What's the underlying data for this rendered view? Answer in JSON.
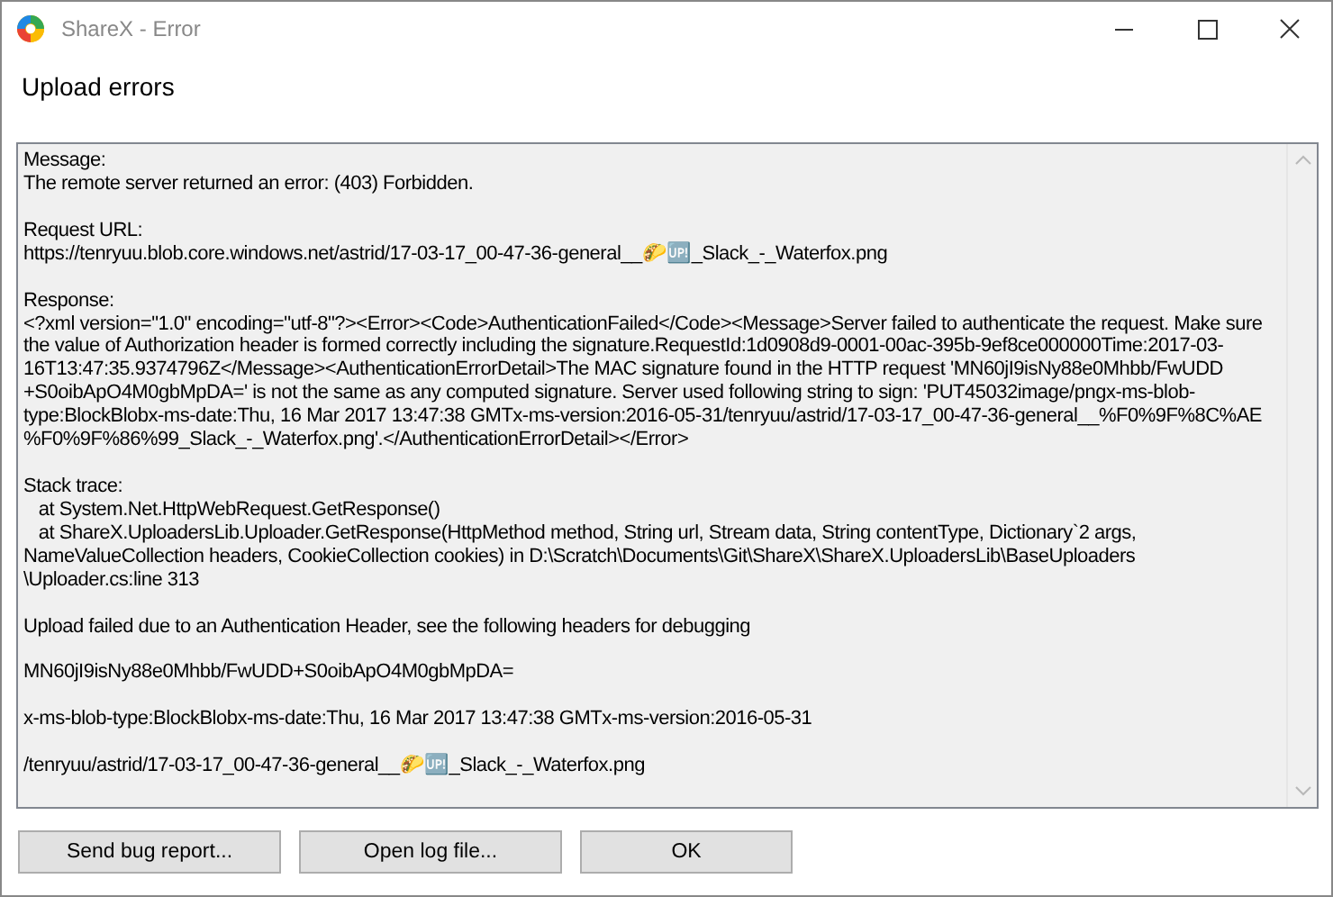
{
  "window": {
    "title": "ShareX - Error"
  },
  "heading": "Upload errors",
  "error_text": [
    {
      "lines": [
        "Message:",
        "The remote server returned an error: (403) Forbidden."
      ]
    },
    {
      "lines": [
        "Request URL:",
        "https://tenryuu.blob.core.windows.net/astrid/17-03-17_00-47-36-general__🌮🆙_Slack_-_Waterfox.png"
      ]
    },
    {
      "lines": [
        "Response:",
        "<?xml version=\"1.0\" encoding=\"utf-8\"?><Error><Code>AuthenticationFailed</Code><Message>Server failed to authenticate the request. Make sure",
        "the value of Authorization header is formed correctly including the signature.RequestId:1d0908d9-0001-00ac-395b-9ef8ce000000Time:2017-03-",
        "16T13:47:35.9374796Z</Message><AuthenticationErrorDetail>The MAC signature found in the HTTP request 'MN60jI9isNy88e0Mhbb/FwUDD",
        "+S0oibApO4M0gbMpDA=' is not the same as any computed signature. Server used following string to sign: 'PUT45032image/pngx-ms-blob-",
        "type:BlockBlobx-ms-date:Thu, 16 Mar 2017 13:47:38 GMTx-ms-version:2016-05-31/tenryuu/astrid/17-03-17_00-47-36-general__%F0%9F%8C%AE",
        "%F0%9F%86%99_Slack_-_Waterfox.png'.</AuthenticationErrorDetail></Error>"
      ]
    },
    {
      "lines": [
        "Stack trace:",
        "   at System.Net.HttpWebRequest.GetResponse()",
        "   at ShareX.UploadersLib.Uploader.GetResponse(HttpMethod method, String url, Stream data, String contentType, Dictionary`2 args,",
        "NameValueCollection headers, CookieCollection cookies) in D:\\Scratch\\Documents\\Git\\ShareX\\ShareX.UploadersLib\\BaseUploaders",
        "\\Uploader.cs:line 313"
      ]
    },
    {
      "lines": [
        "Upload failed due to an Authentication Header, see the following headers for debugging"
      ]
    },
    {
      "lines": [
        "MN60jI9isNy88e0Mhbb/FwUDD+S0oibApO4M0gbMpDA="
      ]
    },
    {
      "lines": [
        "x-ms-blob-type:BlockBlobx-ms-date:Thu, 16 Mar 2017 13:47:38 GMTx-ms-version:2016-05-31"
      ]
    },
    {
      "lines": [
        "/tenryuu/astrid/17-03-17_00-47-36-general__🌮🆙_Slack_-_Waterfox.png"
      ]
    }
  ],
  "buttons": [
    "Send bug report...",
    "Open log file...",
    "OK"
  ]
}
